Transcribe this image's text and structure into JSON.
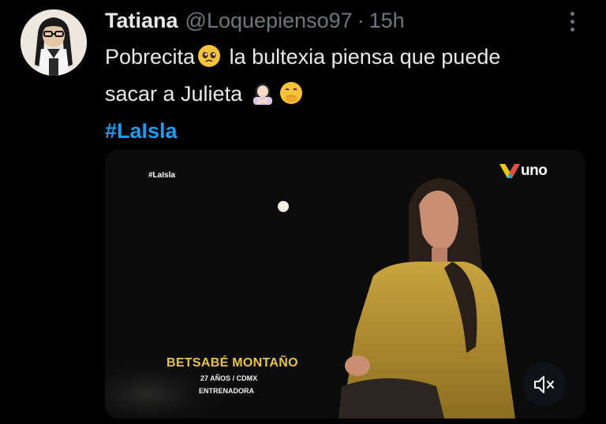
{
  "author": {
    "name": "Tatiana",
    "handle": "@Loquepienso97",
    "separator": "·",
    "time": "15h"
  },
  "tweet": {
    "line1_text": "Pobrecita",
    "line1_rest": "la bultexia piensa que puede",
    "line2_text": "sacar a Julieta",
    "hashtag": "#LaIsla",
    "emojis": [
      "pleading-face-icon",
      "woman-gesturing-no-icon",
      "face-with-hand-over-mouth-icon"
    ]
  },
  "media": {
    "overlay_hashtag": "#LaIsla",
    "channel_logo": "uno",
    "lower_third": {
      "name": "BETSABÉ MONTAÑO",
      "age_city": "27 AÑOS / CDMX",
      "role": "ENTRENADORA"
    },
    "controls": {
      "mute_icon": "speaker-muted-icon"
    }
  },
  "colors": {
    "background": "#000000",
    "text": "#e7e9ea",
    "muted": "#71767b",
    "link": "#1d9bf0",
    "lower_third_name": "#e9c34a"
  }
}
